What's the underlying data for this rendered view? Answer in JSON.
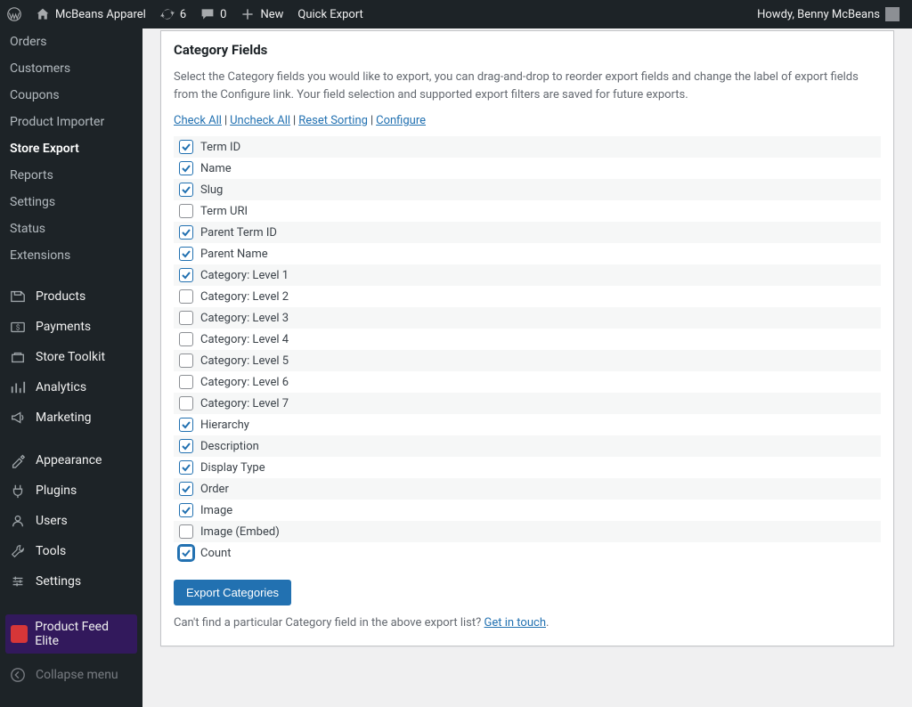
{
  "adminbar": {
    "site_name": "McBeans Apparel",
    "updates_count": "6",
    "comments_count": "0",
    "new_label": "New",
    "quick_export_label": "Quick Export",
    "howdy": "Howdy, Benny McBeans"
  },
  "sidebar": {
    "sub_items": [
      {
        "label": "Orders",
        "current": false
      },
      {
        "label": "Customers",
        "current": false
      },
      {
        "label": "Coupons",
        "current": false
      },
      {
        "label": "Product Importer",
        "current": false
      },
      {
        "label": "Store Export",
        "current": true
      },
      {
        "label": "Reports",
        "current": false
      },
      {
        "label": "Settings",
        "current": false
      },
      {
        "label": "Status",
        "current": false
      },
      {
        "label": "Extensions",
        "current": false
      }
    ],
    "main_items": [
      {
        "label": "Products",
        "icon": "products"
      },
      {
        "label": "Payments",
        "icon": "payments"
      },
      {
        "label": "Store Toolkit",
        "icon": "toolkit"
      },
      {
        "label": "Analytics",
        "icon": "analytics"
      },
      {
        "label": "Marketing",
        "icon": "marketing"
      }
    ],
    "main_items2": [
      {
        "label": "Appearance",
        "icon": "appearance"
      },
      {
        "label": "Plugins",
        "icon": "plugins"
      },
      {
        "label": "Users",
        "icon": "users"
      },
      {
        "label": "Tools",
        "icon": "tools"
      },
      {
        "label": "Settings",
        "icon": "settings"
      }
    ],
    "product_feed_elite": "Product Feed Elite",
    "collapse_label": "Collapse menu"
  },
  "panel": {
    "title": "Category Fields",
    "description": "Select the Category fields you would like to export, you can drag-and-drop to reorder export fields and change the label of export fields from the Configure link. Your field selection and supported export filters are saved for future exports.",
    "link_check_all": "Check All",
    "link_uncheck_all": "Uncheck All",
    "link_reset_sorting": "Reset Sorting",
    "link_configure": "Configure",
    "fields": [
      {
        "label": "Term ID",
        "checked": true
      },
      {
        "label": "Name",
        "checked": true
      },
      {
        "label": "Slug",
        "checked": true
      },
      {
        "label": "Term URI",
        "checked": false
      },
      {
        "label": "Parent Term ID",
        "checked": true
      },
      {
        "label": "Parent Name",
        "checked": true
      },
      {
        "label": "Category: Level 1",
        "checked": true
      },
      {
        "label": "Category: Level 2",
        "checked": false
      },
      {
        "label": "Category: Level 3",
        "checked": false
      },
      {
        "label": "Category: Level 4",
        "checked": false
      },
      {
        "label": "Category: Level 5",
        "checked": false
      },
      {
        "label": "Category: Level 6",
        "checked": false
      },
      {
        "label": "Category: Level 7",
        "checked": false
      },
      {
        "label": "Hierarchy",
        "checked": true
      },
      {
        "label": "Description",
        "checked": true
      },
      {
        "label": "Display Type",
        "checked": true
      },
      {
        "label": "Order",
        "checked": true
      },
      {
        "label": "Image",
        "checked": true
      },
      {
        "label": "Image (Embed)",
        "checked": false
      },
      {
        "label": "Count",
        "checked": true,
        "focus": true
      }
    ],
    "export_button": "Export Categories",
    "footnote_text": "Can't find a particular Category field in the above export list? ",
    "footnote_link": "Get in touch",
    "footnote_suffix": "."
  },
  "icons": {
    "wp": "wp-logo-icon",
    "home": "home-icon",
    "updates": "updates-icon",
    "comments": "comment-icon",
    "plus": "plus-icon"
  }
}
